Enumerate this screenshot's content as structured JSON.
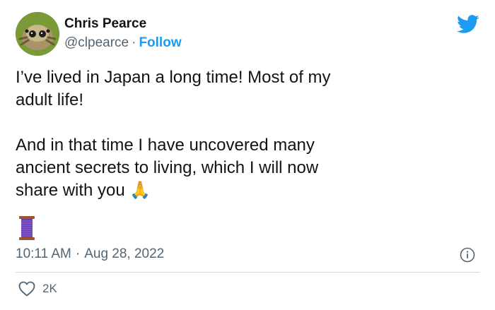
{
  "author": {
    "name": "Chris Pearce",
    "handle": "@clpearce",
    "separator": "·",
    "follow_label": "Follow",
    "avatar_icon": "jumping-spider-avatar"
  },
  "brand": {
    "icon": "twitter-bird-icon",
    "color": "#1d9bf0"
  },
  "tweet": {
    "text": "I’ve lived in Japan a long time! Most of my\nadult life!\n\nAnd in that time I have uncovered many\nancient secrets to living, which I will now\nshare with you 🙏",
    "media_icon": "thread-spool-icon"
  },
  "meta": {
    "time": "10:11 AM",
    "separator": "·",
    "date": "Aug 28, 2022",
    "info_icon": "info-icon"
  },
  "actions": {
    "likes_icon": "heart-icon",
    "likes_count": "2K"
  }
}
